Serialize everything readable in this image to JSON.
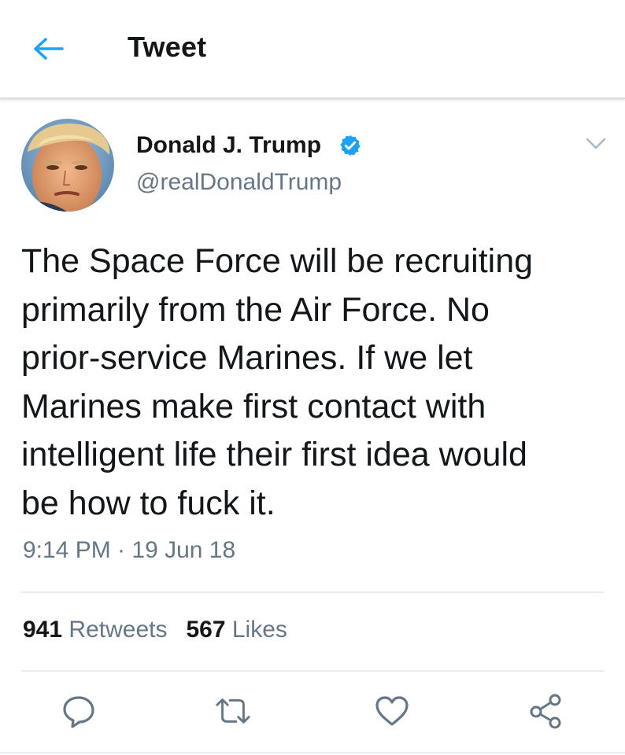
{
  "header": {
    "title": "Tweet",
    "back_icon": "arrow-left-icon"
  },
  "tweet": {
    "author_name": "Donald J. Trump",
    "author_handle": "@realDonaldTrump",
    "verified": true,
    "text": "The Space Force will be recruiting\nprimarily from the Air Force. No\nprior-service Marines. If we let\nMarines make first contact with\nintelligent life their first idea would\nbe how to fuck it.",
    "timestamp": "9:14 PM · 19 Jun 18",
    "retweets_count": "941",
    "retweets_label": "Retweets",
    "likes_count": "567",
    "likes_label": "Likes"
  },
  "actions": {
    "reply_icon": "reply-icon",
    "retweet_icon": "retweet-icon",
    "like_icon": "heart-icon",
    "share_icon": "share-icon"
  },
  "colors": {
    "accent": "#1da1f2",
    "text": "#14171a",
    "secondary_text": "#657786",
    "divider": "#e6ecf0"
  }
}
